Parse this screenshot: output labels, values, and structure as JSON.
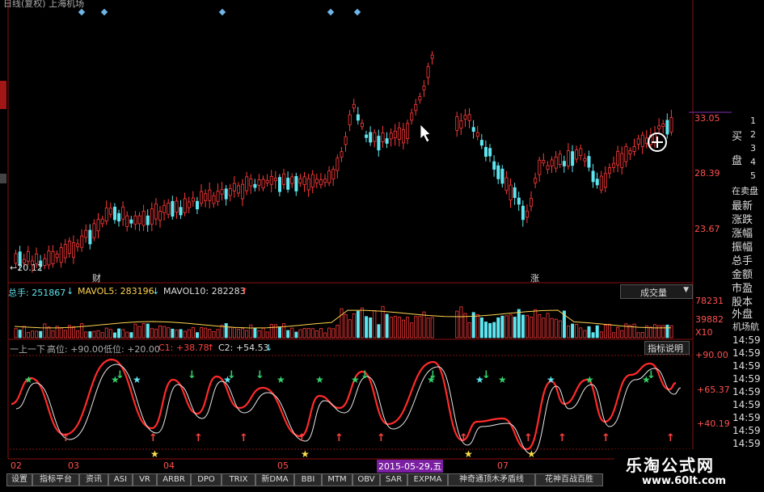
{
  "window": {
    "title": "日线(复权) 上海机场"
  },
  "price_panel": {
    "axis": [
      "33.05",
      "28.39",
      "23.67"
    ],
    "low_label": "←20.12",
    "markers": [
      "财",
      "涨"
    ]
  },
  "volume_panel": {
    "header": {
      "total": "总手: 251867",
      "mavol5": "MAVOL5: 283196",
      "mavol10": "MAVOL10: 282283"
    },
    "dropdown": "成交量",
    "axis": [
      "78231",
      "39882",
      "X10"
    ]
  },
  "indicator_panel": {
    "header": {
      "name": "一上一下",
      "high": "高位: +90.00",
      "low": "低位: +20.00",
      "c1": "C1: +38.78",
      "c2": "C2: +54.53"
    },
    "button": "指标说明",
    "axis": [
      "+90.00",
      "+65.37",
      "+40.19"
    ]
  },
  "date_axis": {
    "labels": [
      "02",
      "03",
      "04",
      "05",
      "07"
    ],
    "selected": "2015-05-29,五"
  },
  "tabs": [
    "设置",
    "指标平台",
    "资讯",
    "ASI",
    "VR",
    "ARBR",
    "DPO",
    "TRIX",
    "新DMA",
    "BBI",
    "MTM",
    "OBV",
    "SAR",
    "EXPMA",
    "神奇通顶木矛盾线",
    "花神百战百胜"
  ],
  "right_panel": {
    "buy_sell": [
      "买",
      "盘"
    ],
    "numbers": [
      "1",
      "2",
      "3",
      "4",
      "5"
    ],
    "sections": [
      "在卖盘",
      "最新",
      "涨跌",
      "涨幅",
      "振幅",
      "总手",
      "金额",
      "市盈",
      "股本",
      "外盘"
    ],
    "stock": "机场航",
    "times": [
      "14:59",
      "14:59",
      "14:59",
      "14:59",
      "14:59",
      "14:59",
      "14:59",
      "14:59",
      "14:59",
      "14:59"
    ]
  },
  "watermark": {
    "cn": "乐淘公式网",
    "url": "www.60lt.com"
  },
  "colors": {
    "up": "#ff3a3a",
    "down": "#5fe5ef",
    "bg": "#000000",
    "grid": "#8a1010"
  }
}
